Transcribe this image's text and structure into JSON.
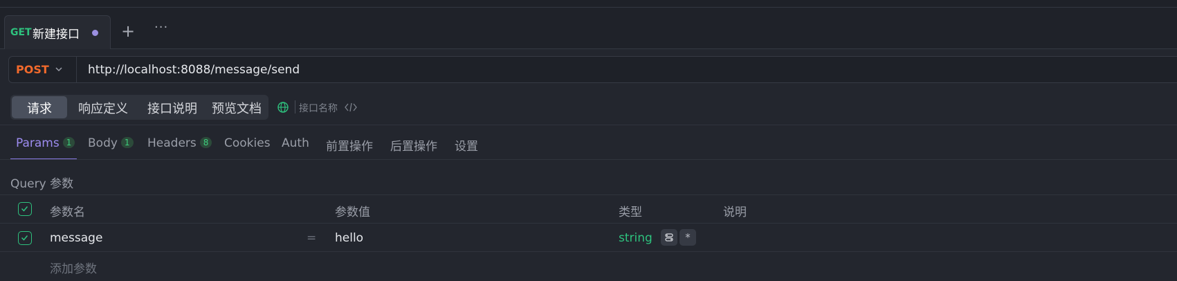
{
  "tab": {
    "method": "GET",
    "title": "新建接口"
  },
  "request": {
    "method": "POST",
    "url": "http://localhost:8088/message/send"
  },
  "segments": [
    {
      "label": "请求",
      "active": true
    },
    {
      "label": "响应定义",
      "active": false
    },
    {
      "label": "接口说明",
      "active": false
    },
    {
      "label": "预览文档",
      "active": false
    }
  ],
  "name_placeholder": "接口名称",
  "subtabs": [
    {
      "label": "Params",
      "count": "1",
      "active": true
    },
    {
      "label": "Body",
      "count": "1"
    },
    {
      "label": "Headers",
      "count": "8"
    },
    {
      "label": "Cookies"
    },
    {
      "label": "Auth"
    },
    {
      "label": "前置操作"
    },
    {
      "label": "后置操作"
    },
    {
      "label": "设置"
    }
  ],
  "query": {
    "title": "Query 参数",
    "columns": [
      "参数名",
      "参数值",
      "类型",
      "说明"
    ],
    "rows": [
      {
        "name": "message",
        "value": "hello",
        "type": "string",
        "required_mark": "*",
        "description": ""
      }
    ],
    "equals": "=",
    "add_label": "添加参数"
  },
  "icons": {
    "tab_add": "plus-icon",
    "tab_more": "more-icon",
    "method_chevron": "chevron-down-icon",
    "env": "globe-icon",
    "code": "code-icon",
    "check": "check-icon",
    "mock": "mock-icon"
  },
  "colors": {
    "post": "#f26a2c",
    "get": "#2ec27e",
    "accent": "#9d8cf0",
    "type": "#2ec27e"
  }
}
